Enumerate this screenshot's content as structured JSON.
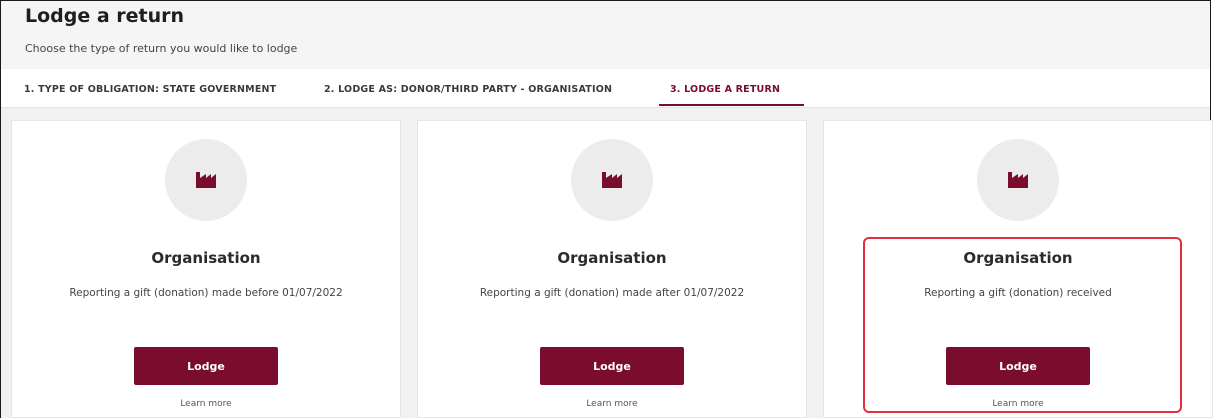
{
  "header": {
    "title": "Lodge a return",
    "subtitle": "Choose the type of return you would like to lodge"
  },
  "tabs": [
    {
      "label": "1. TYPE OF OBLIGATION: STATE GOVERNMENT",
      "active": false
    },
    {
      "label": "2. LODGE AS: DONOR/THIRD PARTY - ORGANISATION",
      "active": false
    },
    {
      "label": "3. LODGE A RETURN",
      "active": true
    }
  ],
  "cards": [
    {
      "icon": "factory-icon",
      "title": "Organisation",
      "description": "Reporting a gift (donation) made before 01/07/2022",
      "button_label": "Lodge",
      "link_label": "Learn more"
    },
    {
      "icon": "factory-icon",
      "title": "Organisation",
      "description": "Reporting a gift (donation) made after 01/07/2022",
      "button_label": "Lodge",
      "link_label": "Learn more"
    },
    {
      "icon": "factory-icon",
      "title": "Organisation",
      "description": "Reporting a gift (donation) received",
      "button_label": "Lodge",
      "link_label": "Learn more"
    }
  ],
  "colors": {
    "brand": "#7a0c2e",
    "highlight": "#e0303c",
    "background": "#f1f1f1"
  }
}
